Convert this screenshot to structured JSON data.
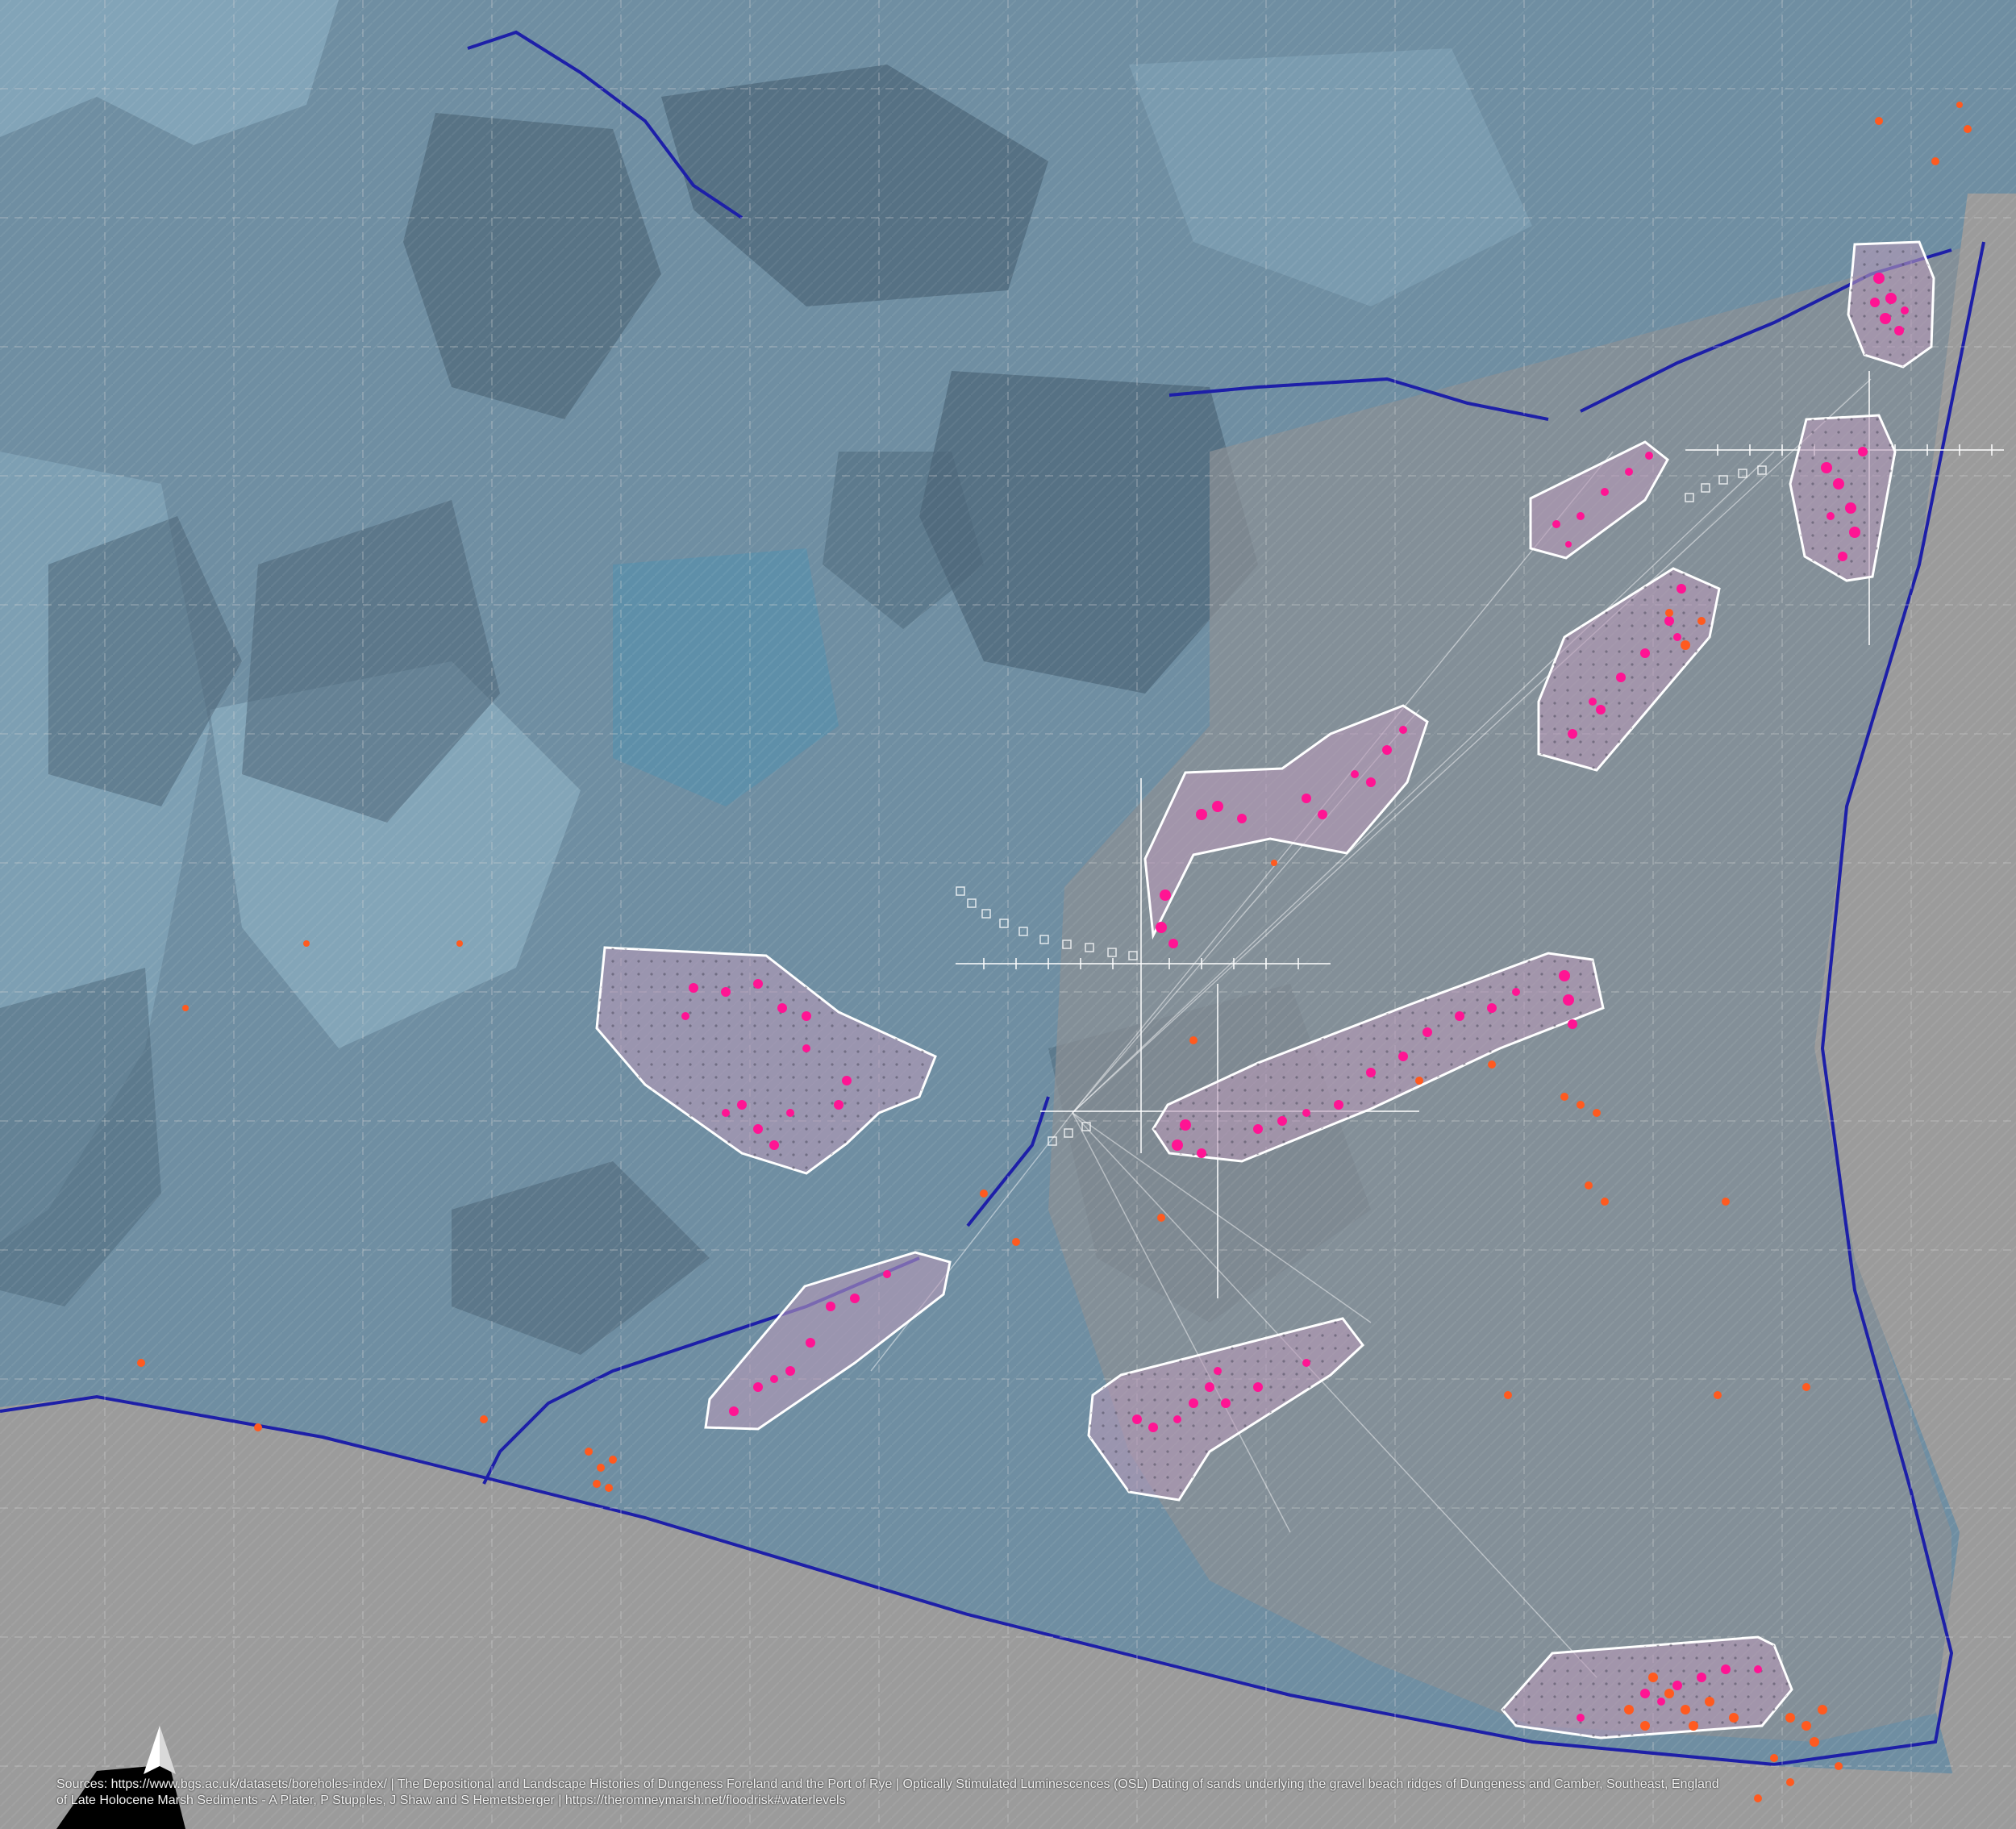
{
  "map": {
    "colors": {
      "land": "#6f8ea2",
      "land_light": "#8fb3c7",
      "land_dark": "#4c6577",
      "gravel": "#8a8f94",
      "sea": "#9b9b9b",
      "river": "#1d1fa8",
      "zone_fill": "#b89ab8",
      "zone_stroke": "#ffffff",
      "borehole_dot": "#ff1493",
      "orange_marker": "#ff5a1f",
      "grid": "#d8d8d8"
    },
    "zones": [
      {
        "id": "zone-1"
      },
      {
        "id": "zone-2"
      },
      {
        "id": "zone-3"
      },
      {
        "id": "zone-4"
      },
      {
        "id": "zone-5"
      },
      {
        "id": "zone-6"
      },
      {
        "id": "zone-7"
      },
      {
        "id": "zone-8"
      },
      {
        "id": "zone-9"
      },
      {
        "id": "zone-10"
      }
    ]
  },
  "legend": {
    "north_arrow_icon": "north-arrow-icon"
  },
  "sources": {
    "line1": "Sources: https://www.bgs.ac.uk/datasets/boreholes-index/  |  The Depositional and Landscape Histories of Dungeness Foreland and the Port of Rye  |  Optically Stimulated Luminescences (OSL) Dating of sands underlying the gravel beach ridges of Dungeness and Camber, Southeast, England",
    "line2": "of Late Holocene Marsh Sediments - A Plater, P Stupples, J Shaw and S Hemetsberger  |  https://theromneymarsh.net/floodrisk#waterlevels"
  }
}
